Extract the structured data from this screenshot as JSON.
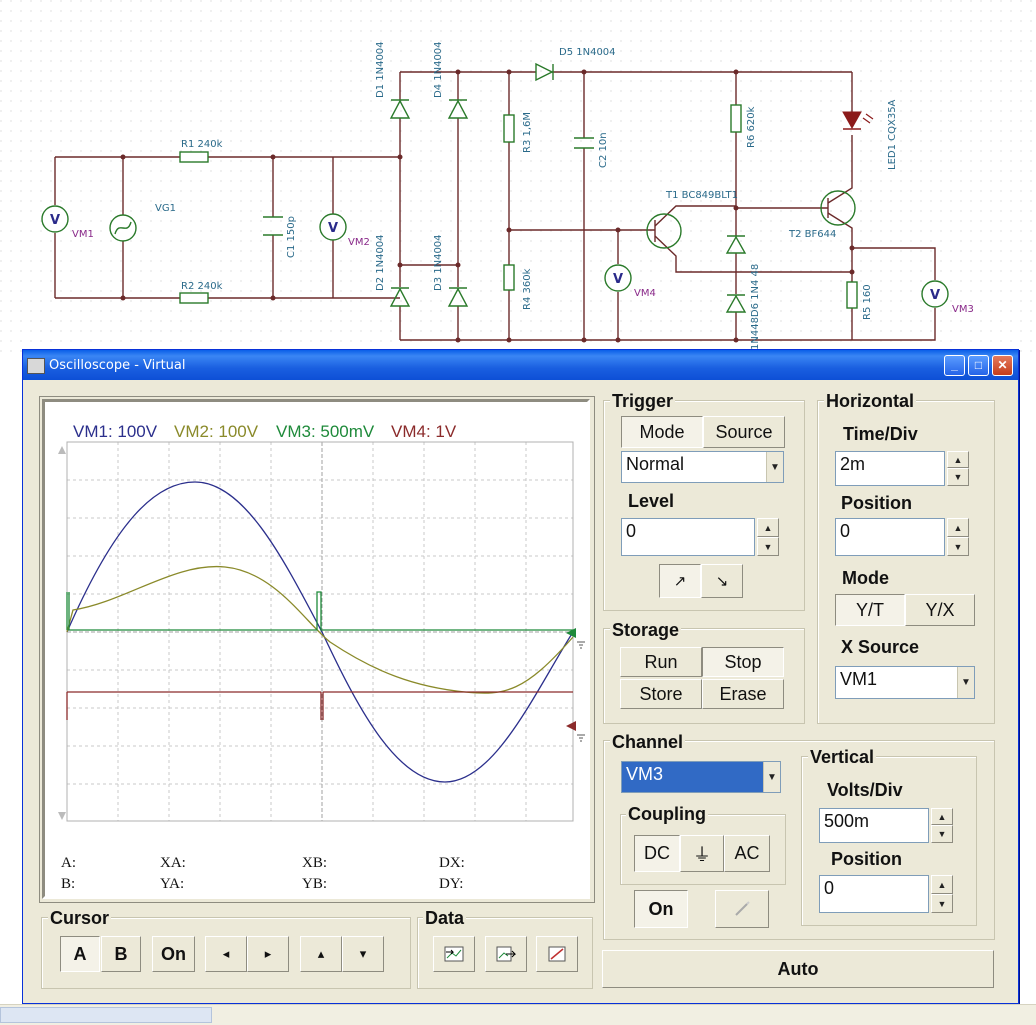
{
  "circuit": {
    "labels": {
      "r1": "R1 240k",
      "r2": "R2 240k",
      "vg1": "VG1",
      "c1": "C1 150p",
      "vm1": "VM1",
      "vm2": "VM2",
      "vm3": "VM3",
      "vm4": "VM4",
      "d1": "D1 1N4004",
      "d2": "D2 1N4004",
      "d3": "D3 1N4004",
      "d4": "D4 1N4004",
      "d5": "D5 1N4004",
      "r3": "R3 1,6M",
      "r4": "R4 360k",
      "c2": "C2 10n",
      "r6": "R6 620k",
      "t1": "T1 BC849BLT1",
      "d6": "1N448D6 1N4 48",
      "t2": "T2 BF644",
      "r5": "R5 160",
      "led1": "LED1 CQX35A",
      "meter_symbol": "V"
    }
  },
  "window": {
    "title": "Oscilloscope - Virtual",
    "minimize": "_",
    "maximize": "□",
    "close": "✕"
  },
  "scope": {
    "channels": [
      {
        "label": "VM1: 100V",
        "color": "#2b2f8c"
      },
      {
        "label": "VM2: 100V",
        "color": "#8a8a2a"
      },
      {
        "label": "VM3: 500mV",
        "color": "#1e8a3a"
      },
      {
        "label": "VM4: 1V",
        "color": "#8b2b2b"
      }
    ],
    "cursor_readout": {
      "a": "A:",
      "b": "B:",
      "xa": "XA:",
      "ya": "YA:",
      "xb": "XB:",
      "yb": "YB:",
      "dx": "DX:",
      "dy": "DY:"
    }
  },
  "trigger": {
    "title": "Trigger",
    "mode_label": "Mode",
    "source_label": "Source",
    "mode_value": "Normal",
    "level_label": "Level",
    "level_value": "0",
    "rise_icon": "↗",
    "fall_icon": "↘"
  },
  "storage": {
    "title": "Storage",
    "run": "Run",
    "stop": "Stop",
    "store": "Store",
    "erase": "Erase"
  },
  "horizontal": {
    "title": "Horizontal",
    "time_div_label": "Time/Div",
    "time_div_value": "2m",
    "position_label": "Position",
    "position_value": "0",
    "mode_label": "Mode",
    "yt": "Y/T",
    "yx": "Y/X",
    "xsource_label": "X Source",
    "xsource_value": "VM1"
  },
  "channel": {
    "title": "Channel",
    "value": "VM3",
    "coupling_label": "Coupling",
    "dc": "DC",
    "gnd": "⏚",
    "ac": "AC",
    "on": "On"
  },
  "vertical": {
    "title": "Vertical",
    "volts_div_label": "Volts/Div",
    "volts_div_value": "500m",
    "position_label": "Position",
    "position_value": "0"
  },
  "cursor": {
    "title": "Cursor",
    "a": "A",
    "b": "B",
    "on": "On",
    "left": "◂",
    "right": "▸",
    "up": "▴",
    "down": "▾"
  },
  "data": {
    "title": "Data"
  },
  "auto": "Auto",
  "colors": {
    "titlebar": "#0a5fe8",
    "window_bg": "#ece9d8",
    "selection": "#316ac5"
  }
}
